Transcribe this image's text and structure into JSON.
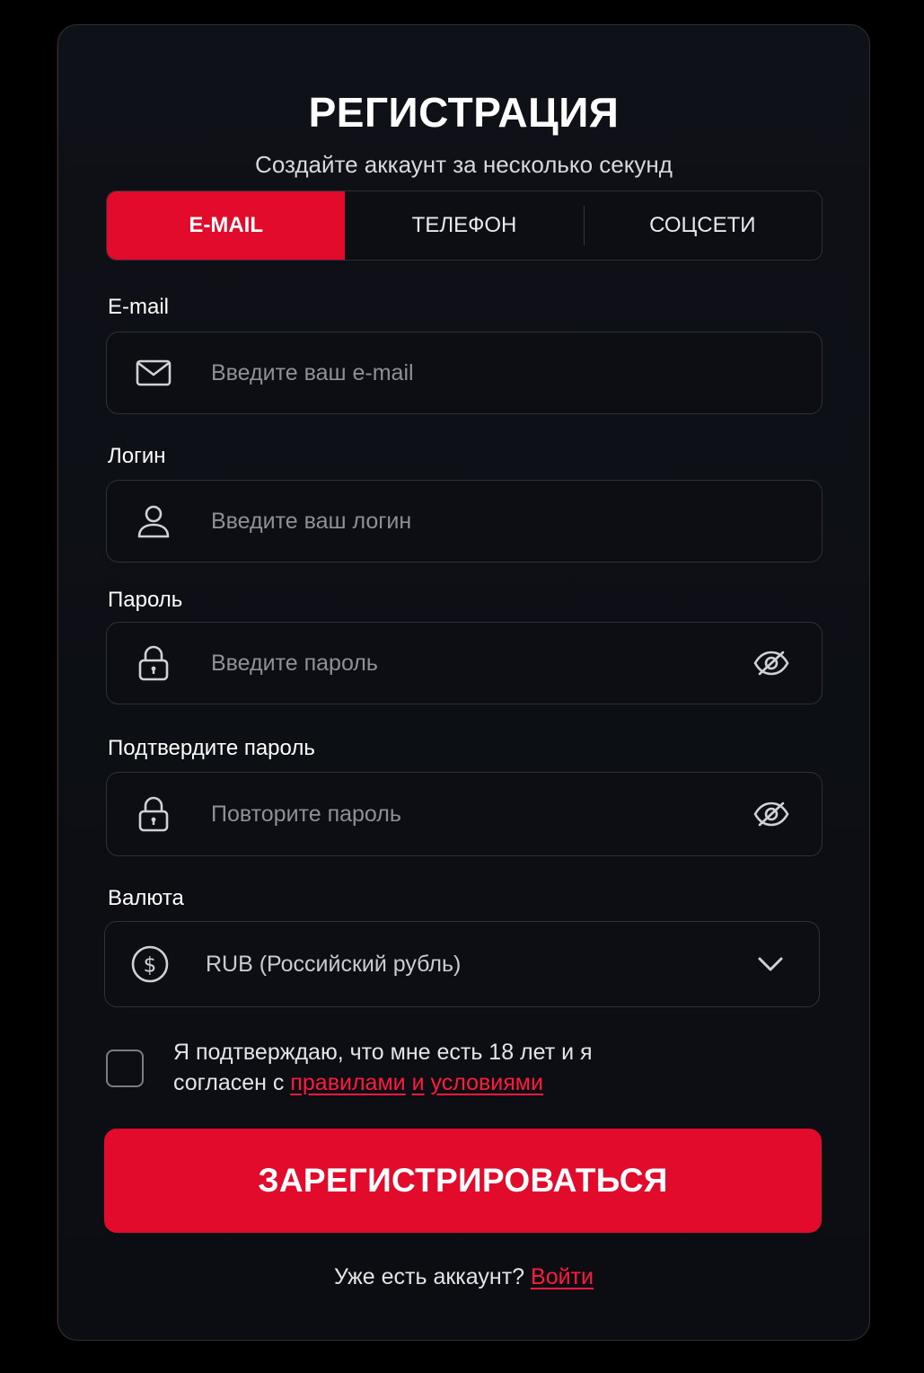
{
  "header": {
    "title": "РЕГИСТРАЦИЯ",
    "subtitle": "Создайте аккаунт за несколько секунд"
  },
  "tabs": [
    {
      "label": "E-MAIL",
      "active": true
    },
    {
      "label": "ТЕЛЕФОН",
      "active": false
    },
    {
      "label": "СОЦСЕТИ",
      "active": false
    }
  ],
  "form": {
    "email": {
      "label": "E-mail",
      "placeholder": "Введите ваш e-mail",
      "icon": "envelope-icon"
    },
    "login": {
      "label": "Логин",
      "placeholder": "Введите ваш логин",
      "icon": "user-icon"
    },
    "password": {
      "label": "Пароль",
      "placeholder": "Введите пароль",
      "icon": "lock-icon"
    },
    "confirm": {
      "label": "Подтвердите пароль",
      "placeholder": "Повторите пароль",
      "icon": "lock-icon"
    },
    "currency": {
      "label": "Валюта",
      "value": "RUB (Российский рубль)",
      "icon": "dollar-circle-icon"
    }
  },
  "agreement": {
    "text_line1": "Я подтверждаю, что мне есть 18 лет и я",
    "text_prefix": "согласен с ",
    "link_rules": "правилами",
    "link_and": "и",
    "link_terms": "условиями",
    "checked": false
  },
  "submit_label": "ЗАРЕГИСТРИРОВАТЬСЯ",
  "footer": {
    "question": "Уже есть аккаунт? ",
    "login_link": "Войти"
  },
  "colors": {
    "accent": "#e30b2c",
    "link": "#ff1a3d",
    "background": "#0c0e13"
  }
}
